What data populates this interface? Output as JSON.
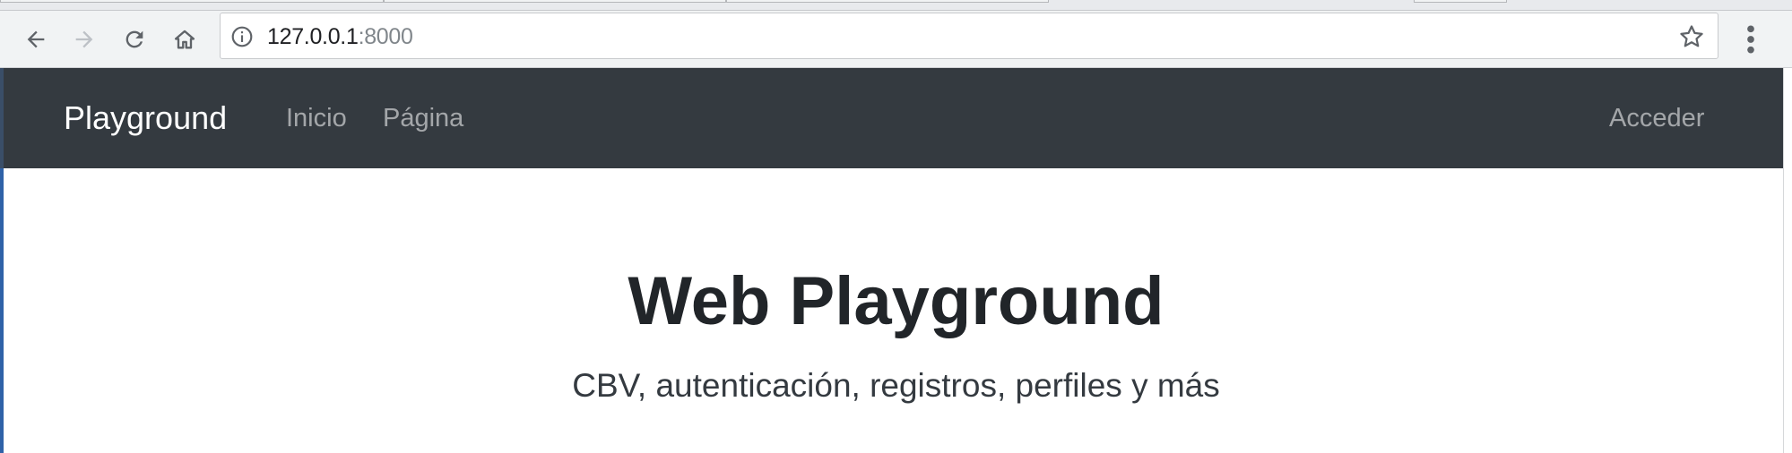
{
  "browser": {
    "address": {
      "host": "127.0.0.1",
      "port": ":8000"
    },
    "icons": {
      "back": "back-arrow-icon",
      "forward": "forward-arrow-icon",
      "reload": "reload-icon",
      "home": "home-icon",
      "site_info": "info-icon",
      "bookmark": "star-icon",
      "menu": "kebab-menu-icon"
    }
  },
  "navbar": {
    "brand": "Playground",
    "links": [
      {
        "label": "Inicio"
      },
      {
        "label": "Página"
      }
    ],
    "login_label": "Acceder",
    "background_color": "#343a40"
  },
  "hero": {
    "title": "Web Playground",
    "subtitle": "CBV, autenticación, registros, perfiles y más"
  }
}
